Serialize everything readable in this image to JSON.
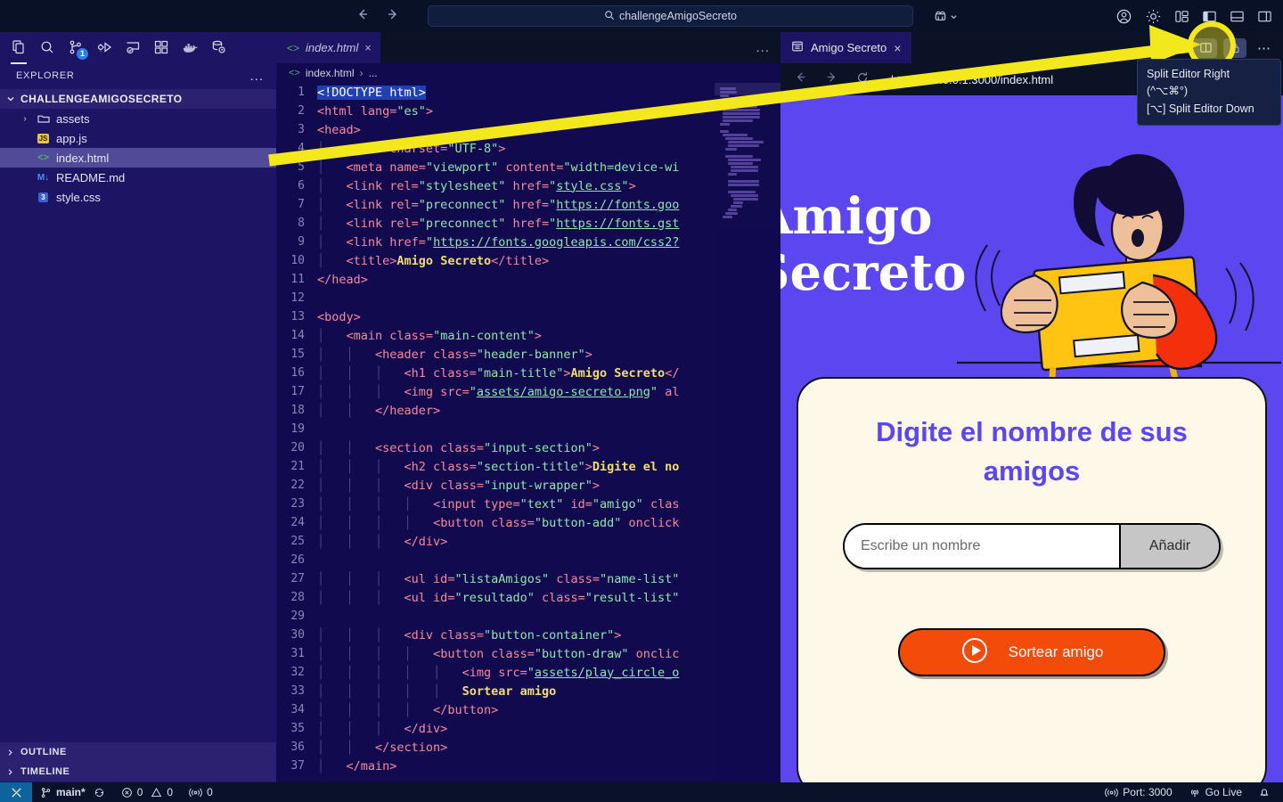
{
  "titlebar": {
    "search_value": "challengeAmigoSecreto",
    "search_icon": "search-icon",
    "back_icon": "back-arrow-icon",
    "forward_icon": "forward-arrow-icon",
    "remote_icon": "remote-explorer-icon",
    "account_icon": "account-icon",
    "settings_icon": "gear-icon",
    "layout_icon": "customize-layout-icon",
    "panel_left_icon": "toggle-primary-sidebar-icon",
    "panel_bottom_icon": "toggle-panel-icon",
    "panel_right_icon": "toggle-secondary-sidebar-icon"
  },
  "activitybar": {
    "items": [
      {
        "name": "explorer",
        "icon": "files-icon",
        "badge": "",
        "active": true
      },
      {
        "name": "search",
        "icon": "search-icon",
        "badge": "",
        "active": false
      },
      {
        "name": "source-control",
        "icon": "source-control-icon",
        "badge": "1",
        "active": false
      },
      {
        "name": "run-and-debug",
        "icon": "run-debug-icon",
        "badge": "",
        "active": false
      },
      {
        "name": "remote-explorer",
        "icon": "remote-window-icon",
        "badge": "",
        "active": false
      },
      {
        "name": "extensions",
        "icon": "extensions-icon",
        "badge": "",
        "active": false
      },
      {
        "name": "docker",
        "icon": "docker-whale-icon",
        "badge": "",
        "active": false
      },
      {
        "name": "database",
        "icon": "database-icon",
        "badge": "",
        "active": false
      }
    ]
  },
  "explorer": {
    "title": "EXPLORER",
    "more_label": "...",
    "root_folder": "CHALLENGEAMIGOSECRETO",
    "files": [
      {
        "label": "assets",
        "type": "folder",
        "icon": "folder-icon",
        "expandable": true,
        "selected": false
      },
      {
        "label": "app.js",
        "type": "file",
        "icon": "js-file-icon",
        "expandable": false,
        "selected": false
      },
      {
        "label": "index.html",
        "type": "file",
        "icon": "html-file-icon",
        "expandable": false,
        "selected": true
      },
      {
        "label": "README.md",
        "type": "file",
        "icon": "markdown-file-icon",
        "expandable": false,
        "selected": false
      },
      {
        "label": "style.css",
        "type": "file",
        "icon": "css-file-icon",
        "expandable": false,
        "selected": false
      }
    ],
    "sections": [
      {
        "label": "OUTLINE",
        "icon": "chevron-right-icon"
      },
      {
        "label": "TIMELINE",
        "icon": "chevron-right-icon"
      }
    ]
  },
  "editor": {
    "tab_label": "index.html",
    "tab_icon": "html-file-icon",
    "tab_close": "×",
    "more_actions": "...",
    "breadcrumb": [
      "index.html",
      "..."
    ],
    "lines": [
      {
        "n": 1,
        "current": true,
        "indent": 0,
        "html": "<span class='t-plain'>&lt;!DOCTYPE html&gt;</span>"
      },
      {
        "n": 2,
        "current": false,
        "indent": 0,
        "html": "<span class='t-tag'>&lt;html lang=</span><span class='t-attr'>\"es\"</span><span class='t-tag'>&gt;</span>"
      },
      {
        "n": 3,
        "current": false,
        "indent": 0,
        "html": "<span class='t-tag'>&lt;head&gt;</span>"
      },
      {
        "n": 4,
        "current": false,
        "indent": 1,
        "html": "<span class='t-tag'>&lt;meta charset=</span><span class='t-attr'>\"UTF-8\"</span><span class='t-tag'>&gt;</span>"
      },
      {
        "n": 5,
        "current": false,
        "indent": 1,
        "html": "<span class='t-tag'>&lt;meta name=</span><span class='t-attr'>\"viewport\"</span><span class='t-tag'> content=</span><span class='t-attr'>\"width=device-wi</span>"
      },
      {
        "n": 6,
        "current": false,
        "indent": 1,
        "html": "<span class='t-tag'>&lt;link rel=</span><span class='t-attr'>\"stylesheet\"</span><span class='t-tag'> href=</span><span class='t-attr'>\"<u>style.css</u>\"</span><span class='t-tag'>&gt;</span>"
      },
      {
        "n": 7,
        "current": false,
        "indent": 1,
        "html": "<span class='t-tag'>&lt;link rel=</span><span class='t-attr'>\"preconnect\"</span><span class='t-tag'> href=</span><span class='t-attr'>\"<u>https://fonts.goo</u></span>"
      },
      {
        "n": 8,
        "current": false,
        "indent": 1,
        "html": "<span class='t-tag'>&lt;link rel=</span><span class='t-attr'>\"preconnect\"</span><span class='t-tag'> href=</span><span class='t-attr'>\"<u>https://fonts.gst</u></span>"
      },
      {
        "n": 9,
        "current": false,
        "indent": 1,
        "html": "<span class='t-tag'>&lt;link href=</span><span class='t-attr'>\"<u>https://fonts.googleapis.com/css2?</u></span>"
      },
      {
        "n": 10,
        "current": false,
        "indent": 1,
        "html": "<span class='t-tag'>&lt;title&gt;</span><span class='t-txt'>Amigo Secreto</span><span class='t-tag'>&lt;/title&gt;</span>"
      },
      {
        "n": 11,
        "current": false,
        "indent": 0,
        "html": "<span class='t-tag'>&lt;/head&gt;</span>"
      },
      {
        "n": 12,
        "current": false,
        "indent": 0,
        "html": ""
      },
      {
        "n": 13,
        "current": false,
        "indent": 0,
        "html": "<span class='t-tag'>&lt;body&gt;</span>"
      },
      {
        "n": 14,
        "current": false,
        "indent": 1,
        "html": "<span class='t-tag'>&lt;main class=</span><span class='t-attr'>\"main-content\"</span><span class='t-tag'>&gt;</span>"
      },
      {
        "n": 15,
        "current": false,
        "indent": 2,
        "html": "<span class='t-tag'>&lt;header class=</span><span class='t-attr'>\"header-banner\"</span><span class='t-tag'>&gt;</span>"
      },
      {
        "n": 16,
        "current": false,
        "indent": 3,
        "html": "<span class='t-tag'>&lt;h1 class=</span><span class='t-attr'>\"main-title\"</span><span class='t-tag'>&gt;</span><span class='t-txt'>Amigo Secreto</span><span class='t-tag'>&lt;/</span>"
      },
      {
        "n": 17,
        "current": false,
        "indent": 3,
        "html": "<span class='t-tag'>&lt;img src=</span><span class='t-attr'>\"<u>assets/amigo-secreto.png</u>\"</span><span class='t-tag'> al</span>"
      },
      {
        "n": 18,
        "current": false,
        "indent": 2,
        "html": "<span class='t-tag'>&lt;/header&gt;</span>"
      },
      {
        "n": 19,
        "current": false,
        "indent": 0,
        "html": ""
      },
      {
        "n": 20,
        "current": false,
        "indent": 2,
        "html": "<span class='t-tag'>&lt;section class=</span><span class='t-attr'>\"input-section\"</span><span class='t-tag'>&gt;</span>"
      },
      {
        "n": 21,
        "current": false,
        "indent": 3,
        "html": "<span class='t-tag'>&lt;h2 class=</span><span class='t-attr'>\"section-title\"</span><span class='t-tag'>&gt;</span><span class='t-txt'>Digite el no</span>"
      },
      {
        "n": 22,
        "current": false,
        "indent": 3,
        "html": "<span class='t-tag'>&lt;div class=</span><span class='t-attr'>\"input-wrapper\"</span><span class='t-tag'>&gt;</span>"
      },
      {
        "n": 23,
        "current": false,
        "indent": 4,
        "html": "<span class='t-tag'>&lt;input type=</span><span class='t-attr'>\"text\"</span><span class='t-tag'> id=</span><span class='t-attr'>\"amigo\"</span><span class='t-tag'> clas</span>"
      },
      {
        "n": 24,
        "current": false,
        "indent": 4,
        "html": "<span class='t-tag'>&lt;button class=</span><span class='t-attr'>\"button-add\"</span><span class='t-tag'> onclick</span>"
      },
      {
        "n": 25,
        "current": false,
        "indent": 3,
        "html": "<span class='t-tag'>&lt;/div&gt;</span>"
      },
      {
        "n": 26,
        "current": false,
        "indent": 0,
        "html": ""
      },
      {
        "n": 27,
        "current": false,
        "indent": 3,
        "html": "<span class='t-tag'>&lt;ul id=</span><span class='t-attr'>\"listaAmigos\"</span><span class='t-tag'> class=</span><span class='t-attr'>\"name-list\"</span>"
      },
      {
        "n": 28,
        "current": false,
        "indent": 3,
        "html": "<span class='t-tag'>&lt;ul id=</span><span class='t-attr'>\"resultado\"</span><span class='t-tag'> class=</span><span class='t-attr'>\"result-list\"</span>"
      },
      {
        "n": 29,
        "current": false,
        "indent": 0,
        "html": ""
      },
      {
        "n": 30,
        "current": false,
        "indent": 3,
        "html": "<span class='t-tag'>&lt;div class=</span><span class='t-attr'>\"button-container\"</span><span class='t-tag'>&gt;</span>"
      },
      {
        "n": 31,
        "current": false,
        "indent": 4,
        "html": "<span class='t-tag'>&lt;button class=</span><span class='t-attr'>\"button-draw\"</span><span class='t-tag'> onclic</span>"
      },
      {
        "n": 32,
        "current": false,
        "indent": 5,
        "html": "<span class='t-tag'>&lt;img src=</span><span class='t-attr'>\"<u>assets/play_circle_o</u></span>"
      },
      {
        "n": 33,
        "current": false,
        "indent": 5,
        "html": "<span class='t-txt'>Sortear amigo</span>"
      },
      {
        "n": 34,
        "current": false,
        "indent": 4,
        "html": "<span class='t-tag'>&lt;/button&gt;</span>"
      },
      {
        "n": 35,
        "current": false,
        "indent": 3,
        "html": "<span class='t-tag'>&lt;/div&gt;</span>"
      },
      {
        "n": 36,
        "current": false,
        "indent": 2,
        "html": "<span class='t-tag'>&lt;/section&gt;</span>"
      },
      {
        "n": 37,
        "current": false,
        "indent": 1,
        "html": "<span class='t-tag'>&lt;/main&gt;</span>"
      }
    ]
  },
  "preview": {
    "tab_label": "Amigo Secreto",
    "tab_icon": "preview-icon",
    "tab_close": "×",
    "back_icon": "back-arrow-icon",
    "forward_icon": "forward-arrow-icon",
    "reload_icon": "reload-icon",
    "url": "http://127.0.0.1:3000/index.html",
    "split_icon": "split-editor-icon",
    "lock_icon": "lock-icon",
    "more_icon": "more-actions-icon"
  },
  "tooltip": {
    "line1": "Split Editor Right (^⌥⌘°)",
    "line2": "[⌥] Split Editor Down"
  },
  "app": {
    "hero_title_line1": "Amigo",
    "hero_title_line2": "Secreto",
    "illustration": "person-holding-card-illustration",
    "section_title": "Digite el nombre de sus amigos",
    "input_placeholder": "Escribe un nombre",
    "input_value": "",
    "add_button": "Añadir",
    "draw_button": "Sortear amigo",
    "draw_button_icon": "play-circle-icon",
    "colors": {
      "hero_bg": "#5b46f0",
      "card_bg": "#fdf8e8",
      "title_color": "#5b46f0",
      "draw_button_bg": "#f34b09",
      "add_button_bg": "#c6c6c6"
    }
  },
  "statusbar": {
    "remote_icon": "remote-indicator-icon",
    "branch": "main*",
    "branch_icon": "source-control-icon",
    "sync_icon": "sync-icon",
    "errors": "0",
    "errors_icon": "error-icon",
    "warnings": "0",
    "warnings_icon": "warning-icon",
    "ports": "0",
    "ports_icon": "ports-icon",
    "port_label": "Port: 3000",
    "port_icon": "ports-icon",
    "golive_label": "Go Live",
    "golive_icon": "broadcast-icon",
    "bell_icon": "bell-icon"
  }
}
